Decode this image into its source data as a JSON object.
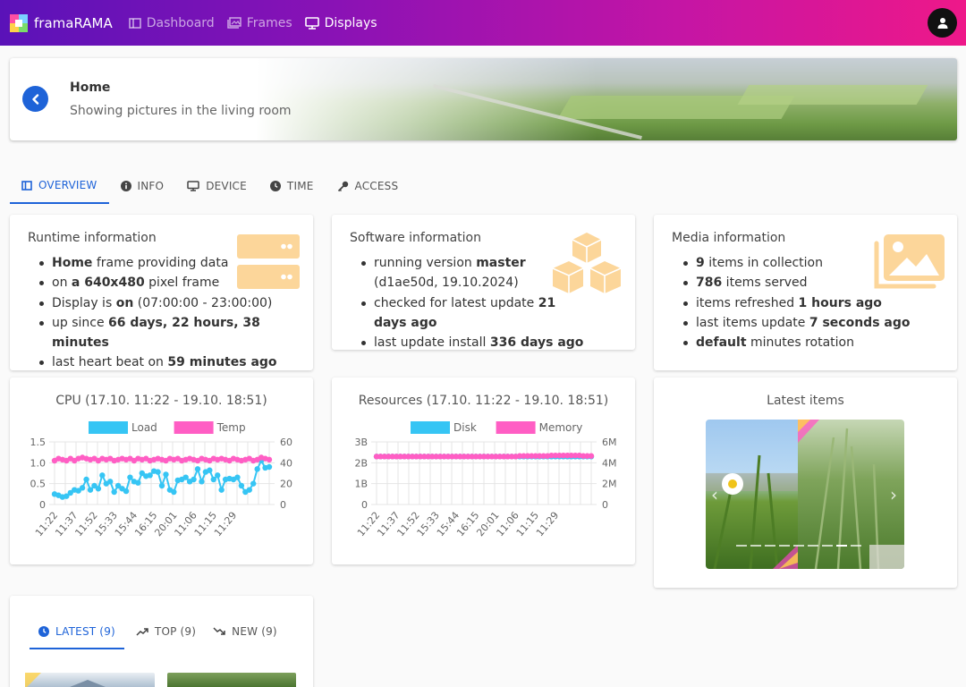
{
  "app": {
    "name": "framaRAMA"
  },
  "nav": [
    {
      "label": "Dashboard",
      "icon": "dashboard-icon",
      "active": false
    },
    {
      "label": "Frames",
      "icon": "frames-icon",
      "active": false
    },
    {
      "label": "Displays",
      "icon": "displays-icon",
      "active": true
    }
  ],
  "header": {
    "title": "Home",
    "subtitle": "Showing pictures in the living room"
  },
  "tabs": [
    {
      "label": "OVERVIEW",
      "icon": "overview-icon",
      "active": true
    },
    {
      "label": "INFO",
      "icon": "info-icon",
      "active": false
    },
    {
      "label": "DEVICE",
      "icon": "device-icon",
      "active": false
    },
    {
      "label": "TIME",
      "icon": "clock-icon",
      "active": false
    },
    {
      "label": "ACCESS",
      "icon": "key-icon",
      "active": false
    }
  ],
  "runtime": {
    "title": "Runtime information",
    "items": [
      {
        "bold": "Home",
        "after": " frame providing data"
      },
      {
        "before": "on ",
        "bold": "a 640x480",
        "after": " pixel frame"
      },
      {
        "before": "Display is ",
        "bold": "on",
        "after": " (07:00:00 - 23:00:00)"
      },
      {
        "before": "up since ",
        "bold": "66 days, 22 hours, 38 minutes"
      },
      {
        "before": "last heart beat on ",
        "bold": "59 minutes ago"
      }
    ]
  },
  "software": {
    "title": "Software information",
    "items": [
      {
        "before": "running version ",
        "bold": "master",
        "after": " (d1ae50d, 19.10.2024)"
      },
      {
        "before": "checked for latest update ",
        "bold": "21 days ago"
      },
      {
        "before": "last update install ",
        "bold": "336 days ago"
      }
    ]
  },
  "media": {
    "title": "Media information",
    "items": [
      {
        "bold": "9",
        "after": " items in collection"
      },
      {
        "bold": "786",
        "after": " items served"
      },
      {
        "before": "items refreshed ",
        "bold": "1 hours ago"
      },
      {
        "before": "last items update ",
        "bold": "7 seconds ago"
      },
      {
        "bold": "default",
        "after": " minutes rotation"
      }
    ]
  },
  "latest_items": {
    "title": "Latest items"
  },
  "bottom_tabs": [
    {
      "label": "LATEST (9)",
      "icon": "clock-icon",
      "active": true
    },
    {
      "label": "TOP (9)",
      "icon": "trending-up-icon",
      "active": false
    },
    {
      "label": "NEW (9)",
      "icon": "trending-down-icon",
      "active": false
    }
  ],
  "colors": {
    "accent": "#1e63d8",
    "load": "#36c5f4",
    "temp": "#ff5ec4",
    "disk": "#36c5f4",
    "memory": "#ff5ec4",
    "icon_orange": "#fcd69a"
  },
  "chart_data": [
    {
      "type": "line",
      "title": "CPU (17.10. 11:22 - 19.10. 18:51)",
      "x_ticks": [
        "11:22",
        "11:37",
        "11:52",
        "15:33",
        "15:44",
        "16:15",
        "20:01",
        "11:06",
        "11:15",
        "11:29"
      ],
      "y_left_ticks": [
        "0",
        "0.5",
        "1.0",
        "1.5"
      ],
      "y_right_ticks": [
        "0",
        "20",
        "40",
        "60"
      ],
      "ylim_left": [
        0,
        1.5
      ],
      "ylim_right": [
        0,
        60
      ],
      "series": [
        {
          "name": "Load",
          "axis": "left",
          "values": [
            0.25,
            0.22,
            0.18,
            0.2,
            0.28,
            0.35,
            0.33,
            0.4,
            0.6,
            0.35,
            0.45,
            0.38,
            0.7,
            0.5,
            0.55,
            0.3,
            0.45,
            0.38,
            0.32,
            0.65,
            0.55,
            0.52,
            0.75,
            0.68,
            0.7,
            0.8,
            0.78,
            0.45,
            0.72,
            0.35,
            0.3,
            0.58,
            0.6,
            0.65,
            0.55,
            0.6,
            0.85,
            0.55,
            0.78,
            0.82,
            0.6,
            0.7,
            0.35,
            0.6,
            0.62,
            0.6,
            0.65,
            0.45,
            0.3,
            0.35,
            0.5,
            0.85,
            1.05,
            0.88,
            0.9
          ]
        },
        {
          "name": "Temp",
          "axis": "right",
          "values": [
            42,
            44,
            43,
            42,
            44,
            42,
            44,
            45,
            44,
            43,
            44,
            42,
            44,
            43,
            44,
            42,
            43,
            44,
            43,
            44,
            42,
            44,
            43,
            44,
            42,
            43,
            44,
            43,
            42,
            44,
            43,
            44,
            42,
            43,
            44,
            43,
            42,
            44,
            43,
            42,
            44,
            43,
            44,
            43,
            42,
            44,
            43,
            42,
            43,
            44,
            42,
            43,
            45,
            44,
            43
          ]
        }
      ]
    },
    {
      "type": "line",
      "title": "Resources (17.10. 11:22 - 19.10. 18:51)",
      "x_ticks": [
        "11:22",
        "11:37",
        "11:52",
        "15:33",
        "15:44",
        "16:15",
        "20:01",
        "11:06",
        "11:15",
        "11:29"
      ],
      "y_left_ticks": [
        "0",
        "1B",
        "2B",
        "3B"
      ],
      "y_right_ticks": [
        "0",
        "2M",
        "4M",
        "6M"
      ],
      "ylim_left": [
        0,
        3
      ],
      "ylim_right": [
        0,
        6
      ],
      "series": [
        {
          "name": "Disk",
          "axis": "left",
          "values": [
            2.3,
            2.3,
            2.3,
            2.3,
            2.3,
            2.3,
            2.3,
            2.3,
            2.3,
            2.3,
            2.3,
            2.3,
            2.3,
            2.3,
            2.3,
            2.3,
            2.3,
            2.3,
            2.3,
            2.3,
            2.3,
            2.3,
            2.3,
            2.3,
            2.3,
            2.3,
            2.3,
            2.3,
            2.3,
            2.3,
            2.3,
            2.3,
            2.3,
            2.3,
            2.3,
            2.3,
            2.3,
            2.3,
            2.3,
            2.3,
            2.3,
            2.3,
            2.3,
            2.3,
            2.3,
            2.3,
            2.3,
            2.3,
            2.3,
            2.3,
            2.3,
            2.3,
            2.3,
            2.3,
            2.3
          ]
        },
        {
          "name": "Memory",
          "axis": "right",
          "values": [
            4.6,
            4.6,
            4.6,
            4.6,
            4.6,
            4.6,
            4.6,
            4.6,
            4.6,
            4.6,
            4.6,
            4.6,
            4.6,
            4.6,
            4.6,
            4.6,
            4.6,
            4.6,
            4.6,
            4.6,
            4.6,
            4.6,
            4.6,
            4.6,
            4.6,
            4.6,
            4.6,
            4.6,
            4.6,
            4.6,
            4.6,
            4.6,
            4.6,
            4.6,
            4.6,
            4.6,
            4.65,
            4.65,
            4.65,
            4.65,
            4.65,
            4.65,
            4.65,
            4.65,
            4.7,
            4.7,
            4.7,
            4.7,
            4.7,
            4.7,
            4.7,
            4.7,
            4.65,
            4.65,
            4.65
          ]
        }
      ]
    }
  ]
}
